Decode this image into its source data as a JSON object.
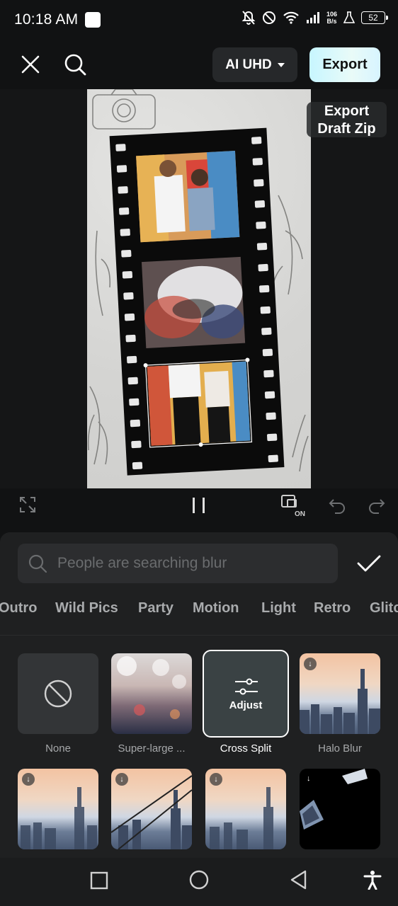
{
  "status": {
    "time": "10:18 AM",
    "net_speed_value": "106",
    "net_speed_unit": "B/s",
    "battery": "52"
  },
  "toolbar": {
    "resolution_label": "AI UHD",
    "export_label": "Export"
  },
  "preview": {
    "export_draft_label": "Export Draft Zip"
  },
  "search": {
    "placeholder": "People are searching blur"
  },
  "categories": [
    "Outro",
    "Wild Pics",
    "Party",
    "Motion",
    "Light",
    "Retro",
    "Glitc"
  ],
  "effects": [
    {
      "label": "None",
      "selected": false
    },
    {
      "label": "Super-large ...",
      "selected": false
    },
    {
      "label": "Cross Split",
      "selected": true,
      "overlay": "Adjust"
    },
    {
      "label": "Halo Blur",
      "selected": false
    },
    {
      "label": "",
      "selected": false
    },
    {
      "label": "",
      "selected": false
    },
    {
      "label": "",
      "selected": false
    },
    {
      "label": "",
      "selected": false
    }
  ],
  "icons": [
    "close-icon",
    "search-icon",
    "fullscreen-icon",
    "pause-icon",
    "compare-on-icon",
    "undo-icon",
    "redo-icon",
    "check-icon",
    "recent-apps-icon",
    "home-icon",
    "back-icon",
    "accessibility-icon"
  ],
  "colors": {
    "background": "#111213",
    "panel": "#1f2021",
    "export_gradient_start": "#c7f6ff",
    "selected_border": "#ffffff"
  }
}
